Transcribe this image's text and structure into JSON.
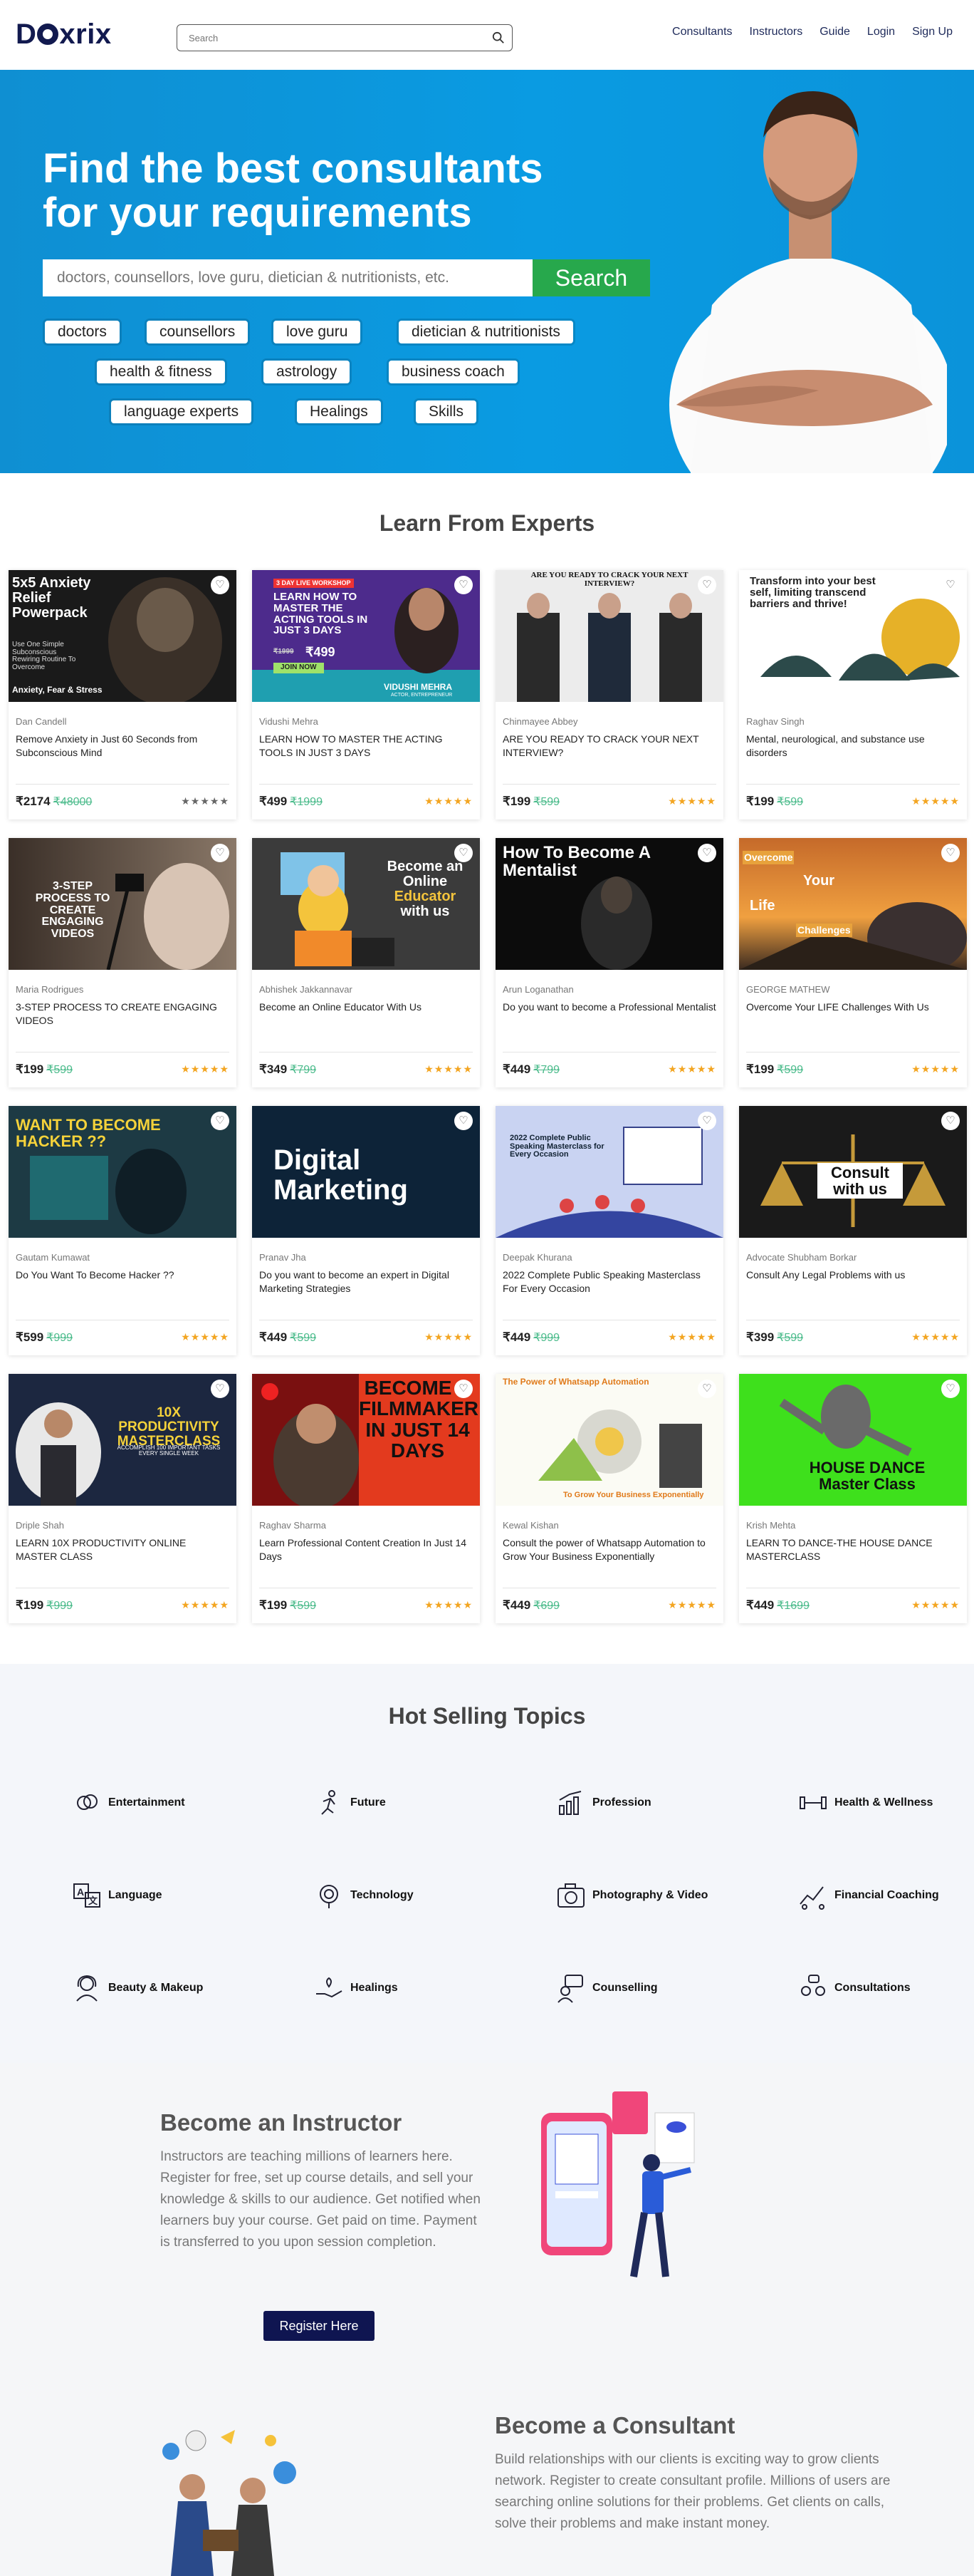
{
  "header": {
    "logo": "Doxrix",
    "search_placeholder": "Search",
    "nav": [
      "Consultants",
      "Instructors",
      "Guide",
      "Login",
      "Sign Up"
    ]
  },
  "hero": {
    "title_line1": "Find the best consultants",
    "title_line2": "for your requirements",
    "search_placeholder": "doctors, counsellors, love guru, dietician & nutritionists, etc.",
    "search_button": "Search",
    "chips": [
      "doctors",
      "counsellors",
      "love guru",
      "dietician & nutritionists",
      "health & fitness",
      "astrology",
      "business coach",
      "language experts",
      "Healings",
      "Skills"
    ]
  },
  "experts": {
    "title": "Learn From Experts",
    "cards": [
      {
        "author": "Dan Candell",
        "title": "Remove Anxiety in Just 60 Seconds from Subconscious Mind",
        "price": "₹2174",
        "old": "₹48000",
        "rating": "★★★★★",
        "thumb_text": "5x5 Anxiety Relief Powerpack",
        "thumb_sub": "Use One Simple Subconscious Rewiring Routine To Overcome",
        "thumb_foot": "Anxiety, Fear & Stress"
      },
      {
        "author": "Vidushi Mehra",
        "title": "LEARN HOW TO MASTER THE ACTING TOOLS IN JUST 3 DAYS",
        "price": "₹499",
        "old": "₹1999",
        "rating": "★★★★★",
        "thumb_text": "LEARN HOW TO MASTER THE ACTING TOOLS IN JUST 3 DAYS",
        "thumb_tag": "3 DAY LIVE WORKSHOP",
        "thumb_price_old": "₹1999",
        "thumb_price": "₹499",
        "thumb_btn": "JOIN NOW",
        "thumb_name": "VIDUSHI MEHRA",
        "thumb_role": "ACTOR, ENTREPRENEUR"
      },
      {
        "author": "Chinmayee Abbey",
        "title": "ARE YOU READY TO CRACK YOUR NEXT INTERVIEW?",
        "price": "₹199",
        "old": "₹599",
        "rating": "★★★★★",
        "thumb_text": "ARE YOU READY TO CRACK YOUR NEXT INTERVIEW?"
      },
      {
        "author": "Raghav Singh",
        "title": "Mental, neurological, and substance use disorders",
        "price": "₹199",
        "old": "₹599",
        "rating": "★★★★★",
        "thumb_text": "Transform into your best self, limiting transcend barriers and thrive!"
      },
      {
        "author": "Maria Rodrigues",
        "title": "3-STEP PROCESS TO CREATE ENGAGING VIDEOS",
        "price": "₹199",
        "old": "₹599",
        "rating": "★★★★★",
        "thumb_text": "3-STEP PROCESS TO CREATE ENGAGING VIDEOS"
      },
      {
        "author": "Abhishek Jakkannavar",
        "title": "Become an Online Educator With Us",
        "price": "₹349",
        "old": "₹799",
        "rating": "★★★★★",
        "thumb_text": "Become an Online",
        "thumb_accent": "Educator",
        "thumb_tail": "with us"
      },
      {
        "author": "Arun Loganathan",
        "title": "Do you want to become a Professional Mentalist",
        "price": "₹449",
        "old": "₹799",
        "rating": "★★★★★",
        "thumb_text": "How To Become A Mentalist"
      },
      {
        "author": "GEORGE MATHEW",
        "title": "Overcome Your LIFE Challenges With Us",
        "price": "₹199",
        "old": "₹599",
        "rating": "★★★★★",
        "thumb_text": "Overcome",
        "thumb_your": "Your",
        "thumb_life": "Life",
        "thumb_chal": "Challenges"
      },
      {
        "author": "Gautam Kumawat",
        "title": "Do You Want To Become Hacker ??",
        "price": "₹599",
        "old": "₹999",
        "rating": "★★★★★",
        "thumb_text": "WANT TO BECOME HACKER ??"
      },
      {
        "author": "Pranav Jha",
        "title": "Do you want to become an expert in Digital Marketing Strategies",
        "price": "₹449",
        "old": "₹599",
        "rating": "★★★★★",
        "thumb_text": "Digital Marketing"
      },
      {
        "author": "Deepak Khurana",
        "title": "2022 Complete Public Speaking Masterclass For Every Occasion",
        "price": "₹449",
        "old": "₹999",
        "rating": "★★★★★",
        "thumb_text": "2022 Complete Public Speaking Masterclass for Every Occasion"
      },
      {
        "author": "Advocate Shubham Borkar",
        "title": "Consult Any Legal Problems with us",
        "price": "₹399",
        "old": "₹599",
        "rating": "★★★★★",
        "thumb_text": "Consult with us"
      },
      {
        "author": "Driple Shah",
        "title": "LEARN 10X PRODUCTIVITY ONLINE MASTER CLASS",
        "price": "₹199",
        "old": "₹999",
        "rating": "★★★★★",
        "thumb_text": "10X PRODUCTIVITY MASTERCLASS",
        "thumb_sub": "ACCOMPLISH 100 IMPORTANT TASKS EVERY SINGLE WEEK"
      },
      {
        "author": "Raghav Sharma",
        "title": "Learn Professional Content Creation In Just 14 Days",
        "price": "₹199",
        "old": "₹599",
        "rating": "★★★★★",
        "thumb_text": "BECOME A FILMMAKER IN JUST 14 DAYS"
      },
      {
        "author": "Kewal Kishan",
        "title": "Consult the power of Whatsapp Automation to Grow Your Business Exponentially",
        "price": "₹449",
        "old": "₹699",
        "rating": "★★★★★",
        "thumb_text": "The Power of Whatsapp Automation",
        "thumb_sub": "To Grow Your Business Exponentially"
      },
      {
        "author": "Krish Mehta",
        "title": "LEARN TO DANCE-THE HOUSE DANCE MASTERCLASS",
        "price": "₹449",
        "old": "₹1699",
        "rating": "★★★★★",
        "thumb_text": "HOUSE DANCE Master Class"
      }
    ]
  },
  "topics": {
    "title": "Hot Selling Topics",
    "items": [
      "Entertainment",
      "Future",
      "Profession",
      "Health & Wellness",
      "Language",
      "Technology",
      "Photography & Video",
      "Financial Coaching",
      "Beauty & Makeup",
      "Healings",
      "Counselling",
      "Consultations"
    ]
  },
  "instructor": {
    "title": "Become an Instructor",
    "text": "Instructors are teaching millions of learners here. Register for free, set up course details, and sell your knowledge & skills to our audience. Get notified when learners buy your course. Get paid on time. Payment is transferred to you upon session completion.",
    "button": "Register Here"
  },
  "consultant": {
    "title": "Become a Consultant",
    "text": "Build relationships with our clients is exciting way to grow clients network. Register to create consultant profile. Millions of users are searching online solutions for their problems. Get clients on calls, solve their problems and make instant money."
  },
  "colors": {
    "brand": "#121a4f",
    "hero": "#0a9be2",
    "search_btn": "#27a84c",
    "star": "#f3a521",
    "old_price": "#4bbb8b"
  }
}
